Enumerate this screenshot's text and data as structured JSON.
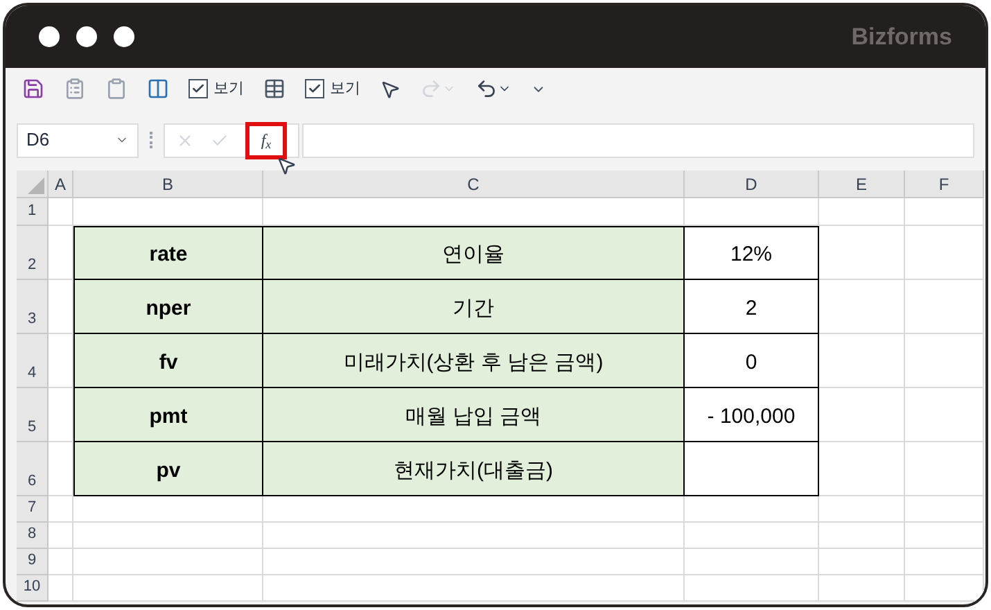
{
  "window": {
    "brand": "Bizforms"
  },
  "toolbar": [
    {
      "kind": "save"
    },
    {
      "kind": "paste-values"
    },
    {
      "kind": "paste-formulas"
    },
    {
      "kind": "fit"
    },
    {
      "kind": "check",
      "label": "보기",
      "checked": true
    },
    {
      "kind": "lock-table"
    },
    {
      "kind": "check",
      "label": "보기",
      "checked": true
    },
    {
      "kind": "pointer"
    },
    {
      "kind": "redo",
      "disabled": true
    },
    {
      "kind": "undo",
      "disabled": false
    },
    {
      "kind": "customize"
    }
  ],
  "formula_bar": {
    "name_box": "D6",
    "fx": "f$_{x}$",
    "fx_highlighted": true
  },
  "sheet": {
    "columns": [
      "A",
      "B",
      "C",
      "D",
      "E",
      "F"
    ],
    "row_numbers": [
      "1",
      "2",
      "3",
      "4",
      "5",
      "6",
      "7",
      "8",
      "9",
      "10"
    ],
    "rows": [
      {
        "name": "rate",
        "meaning": "연이율",
        "value": "12%"
      },
      {
        "name": "nper",
        "meaning": "기간",
        "value": "2"
      },
      {
        "name": "fv",
        "meaning": "미래가치(상환 후 남은 금액)",
        "value": "0"
      },
      {
        "name": "pmt",
        "meaning": "매월 납입 금액",
        "value": "- 100,000"
      },
      {
        "name": "pv",
        "meaning": "현재가치(대출금)",
        "value": ""
      }
    ]
  }
}
